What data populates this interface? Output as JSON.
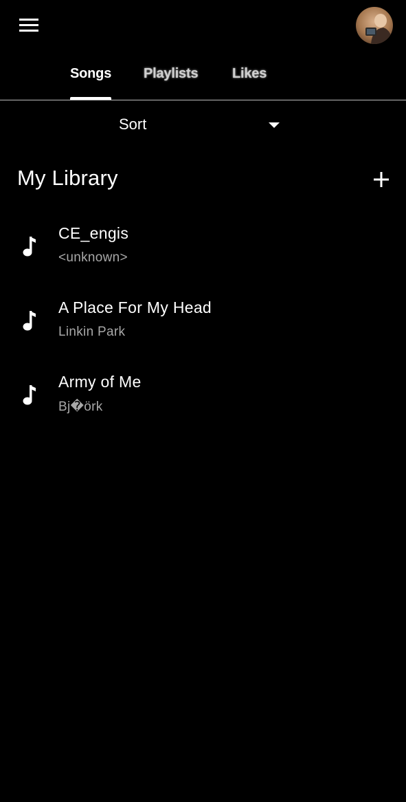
{
  "header": {
    "menu_icon": "hamburger-menu-icon",
    "avatar_icon": "user-avatar"
  },
  "tabs": [
    {
      "label": "Songs",
      "active": true
    },
    {
      "label": "Playlists",
      "active": false
    },
    {
      "label": "Likes",
      "active": false
    }
  ],
  "sort": {
    "label": "Sort",
    "icon": "caret-down-icon"
  },
  "library": {
    "title": "My Library",
    "add_icon": "plus-icon"
  },
  "songs": [
    {
      "title": "CE_engis",
      "artist": "<unknown>",
      "icon": "music-note-icon"
    },
    {
      "title": "A Place For My Head",
      "artist": "Linkin Park",
      "icon": "music-note-icon"
    },
    {
      "title": "Army of Me",
      "artist": "Bj�örk",
      "icon": "music-note-icon"
    }
  ],
  "colors": {
    "background": "#000000",
    "text_primary": "#ffffff",
    "text_secondary": "#a8a8a8",
    "divider": "#bdbdbd"
  }
}
